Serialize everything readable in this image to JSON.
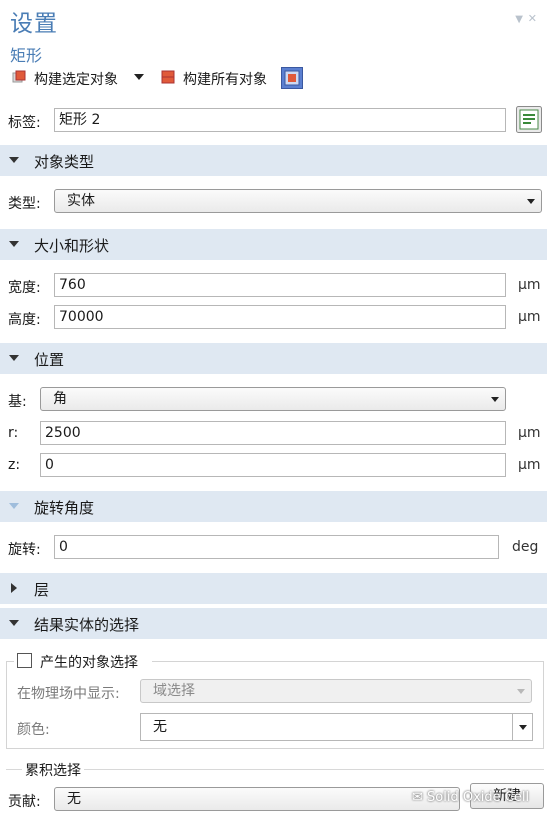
{
  "header": {
    "title": "设置",
    "subtitle": "矩形"
  },
  "toolbar": {
    "build_selected": "构建选定对象",
    "build_all": "构建所有对象"
  },
  "label_row": {
    "label": "标签:",
    "value": "矩形 2"
  },
  "sections": {
    "object_type": "对象类型",
    "size_shape": "大小和形状",
    "position": "位置",
    "rotation": "旋转角度",
    "layers": "层",
    "selection": "结果实体的选择"
  },
  "object_type": {
    "type_label": "类型:",
    "type_value": "实体"
  },
  "size": {
    "width_label": "宽度:",
    "width_value": "760",
    "width_unit": "µm",
    "height_label": "高度:",
    "height_value": "70000",
    "height_unit": "µm"
  },
  "position": {
    "base_label": "基:",
    "base_value": "角",
    "r_label": "r:",
    "r_value": "2500",
    "r_unit": "µm",
    "z_label": "z:",
    "z_value": "0",
    "z_unit": "µm"
  },
  "rotation": {
    "label": "旋转:",
    "value": "0",
    "unit": "deg"
  },
  "selection": {
    "checkbox_label": "产生的对象选择",
    "show_label": "在物理场中显示:",
    "show_value": "域选择",
    "color_label": "颜色:",
    "color_value": "无"
  },
  "cumulative": {
    "legend": "累积选择",
    "contribute_label": "贡献:",
    "contribute_value": "无",
    "new_button": "新建"
  },
  "watermark": "Solid Oxide Cell",
  "colors": {
    "title_blue": "#4a7db5",
    "section_bg": "#dfe8f2"
  }
}
